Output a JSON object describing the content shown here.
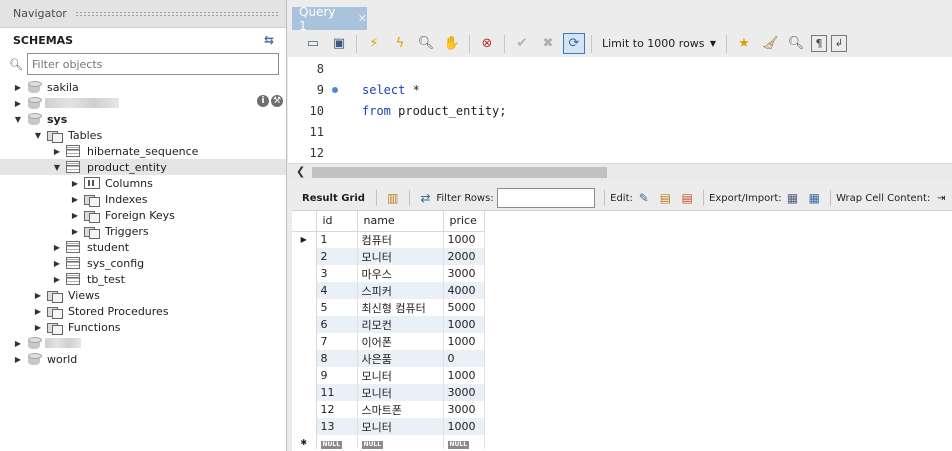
{
  "navigator": {
    "title": "Navigator",
    "schemas_label": "SCHEMAS",
    "filter_placeholder": "Filter objects",
    "tree": {
      "sakila": "sakila",
      "sys": "sys",
      "tables": "Tables",
      "hibernate_sequence": "hibernate_sequence",
      "product_entity": "product_entity",
      "columns": "Columns",
      "indexes": "Indexes",
      "foreign_keys": "Foreign Keys",
      "triggers": "Triggers",
      "student": "student",
      "sys_config": "sys_config",
      "tb_test": "tb_test",
      "views": "Views",
      "stored_procedures": "Stored Procedures",
      "functions": "Functions",
      "world": "world"
    }
  },
  "editor": {
    "tab_label": "Query 1",
    "limit_label": "Limit to 1000 rows",
    "lines": [
      {
        "num": "8",
        "code": ""
      },
      {
        "num": "9",
        "kw": "select",
        "rest": " *"
      },
      {
        "num": "10",
        "kw": "from",
        "rest": " product_entity;"
      },
      {
        "num": "11",
        "code": ""
      },
      {
        "num": "12",
        "code": ""
      }
    ]
  },
  "result": {
    "tab_label": "Result Grid",
    "filter_rows_label": "Filter Rows:",
    "edit_label": "Edit:",
    "export_label": "Export/Import:",
    "wrap_label": "Wrap Cell Content:",
    "columns": [
      "id",
      "name",
      "price"
    ],
    "rows": [
      [
        "1",
        "컴퓨터",
        "1000"
      ],
      [
        "2",
        "모니터",
        "2000"
      ],
      [
        "3",
        "마우스",
        "3000"
      ],
      [
        "4",
        "스피커",
        "4000"
      ],
      [
        "5",
        "최신형 컴퓨터",
        "5000"
      ],
      [
        "6",
        "리모컨",
        "1000"
      ],
      [
        "7",
        "이어폰",
        "1000"
      ],
      [
        "8",
        "사은품",
        "0"
      ],
      [
        "9",
        "모니터",
        "1000"
      ],
      [
        "11",
        "모니터",
        "3000"
      ],
      [
        "12",
        "스마트폰",
        "3000"
      ],
      [
        "13",
        "모니터",
        "1000"
      ]
    ],
    "null_label": "NULL"
  }
}
